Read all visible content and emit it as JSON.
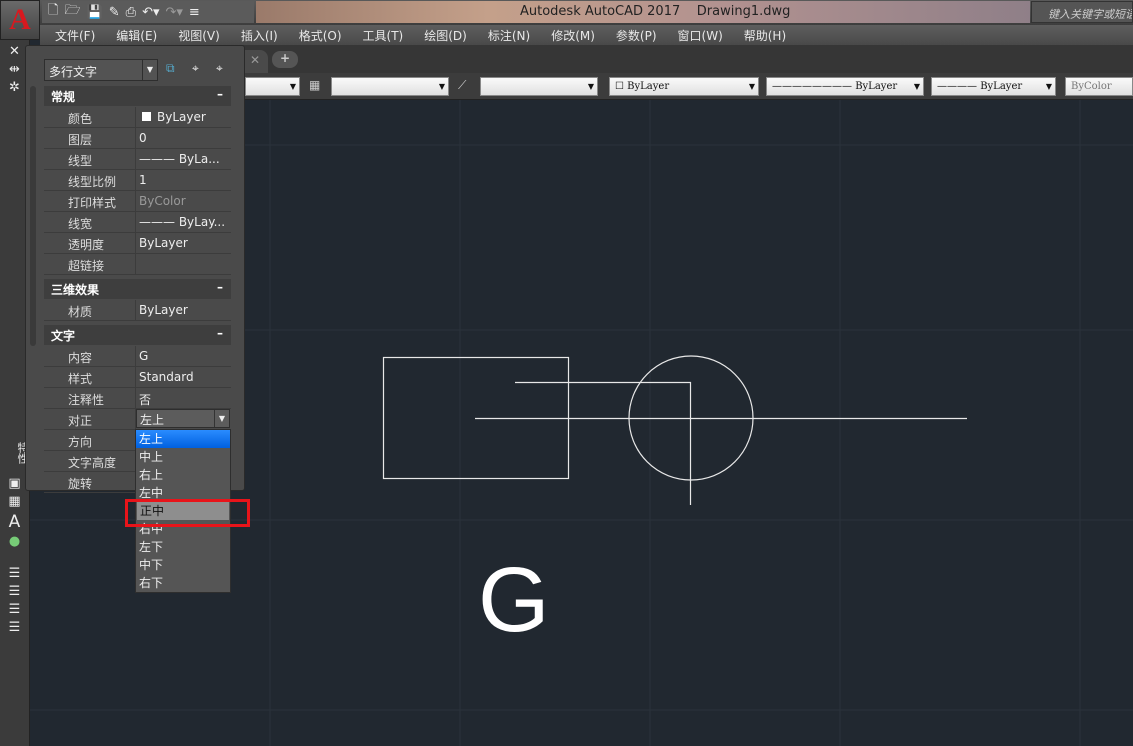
{
  "app": {
    "logo": "A",
    "title": "Autodesk AutoCAD 2017    Drawing1.dwg",
    "search_placeholder": "键入关键字或短语"
  },
  "qat_icons": [
    "new-icon",
    "open-icon",
    "save-icon",
    "save-as-icon",
    "print-icon",
    "undo-icon",
    "redo-icon",
    "customize-icon"
  ],
  "menu": [
    "文件(F)",
    "编辑(E)",
    "视图(V)",
    "插入(I)",
    "格式(O)",
    "工具(T)",
    "绘图(D)",
    "标注(N)",
    "修改(M)",
    "参数(P)",
    "窗口(W)",
    "帮助(H)"
  ],
  "toolbar": {
    "color": "ByLayer",
    "linetype": "ByLayer",
    "lineweight": "ByLayer",
    "plotstyle": "ByColor"
  },
  "palette": {
    "vertical_title": "特性",
    "object_type": "多行文字",
    "sections": {
      "general": {
        "title": "常规",
        "rows": [
          [
            "颜色",
            "ByLayer"
          ],
          [
            "图层",
            "0"
          ],
          [
            "线型",
            "——— ByLa..."
          ],
          [
            "线型比例",
            "1"
          ],
          [
            "打印样式",
            "ByColor"
          ],
          [
            "线宽",
            "——— ByLay..."
          ],
          [
            "透明度",
            "ByLayer"
          ],
          [
            "超链接",
            ""
          ]
        ]
      },
      "3d": {
        "title": "三维效果",
        "rows": [
          [
            "材质",
            "ByLayer"
          ]
        ]
      },
      "text": {
        "title": "文字",
        "rows": [
          [
            "内容",
            "G"
          ],
          [
            "样式",
            "Standard"
          ],
          [
            "注释性",
            "否"
          ],
          [
            "对正",
            "左上"
          ],
          [
            "方向",
            ""
          ],
          [
            "文字高度",
            ""
          ],
          [
            "旋转",
            ""
          ]
        ]
      }
    },
    "collapse": "–",
    "justify_options": [
      "左上",
      "中上",
      "右上",
      "左中",
      "正中",
      "右中",
      "左下",
      "中下",
      "右下"
    ],
    "justify_selected": "左上",
    "justify_hover": "正中"
  },
  "canvas": {
    "text": "G"
  }
}
